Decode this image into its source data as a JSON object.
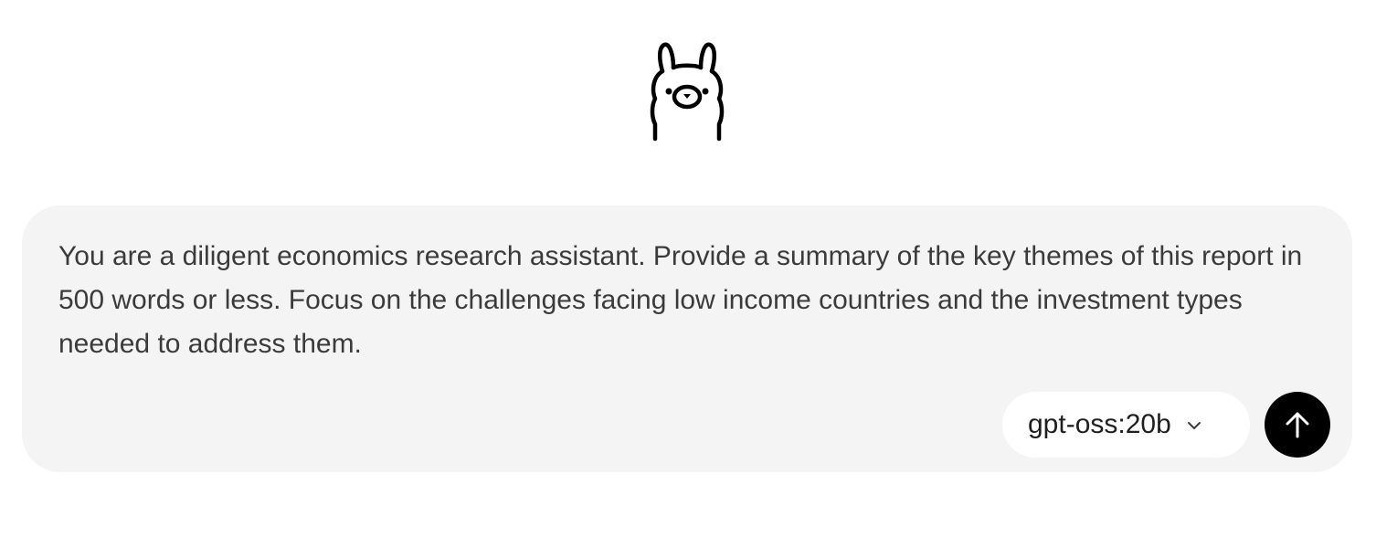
{
  "logo": {
    "icon": "llama-icon"
  },
  "prompt": {
    "text": "You are a diligent economics research assistant. Provide a summary of the key themes of this report in 500 words or less. Focus on the challenges facing low income countries and the investment types needed to address them."
  },
  "model_selector": {
    "value": "gpt-oss:20b",
    "icon": "chevron-down-icon"
  },
  "send_button": {
    "icon": "arrow-up-icon"
  },
  "colors": {
    "card_background": "#f4f4f4",
    "send_button": "#000000"
  }
}
